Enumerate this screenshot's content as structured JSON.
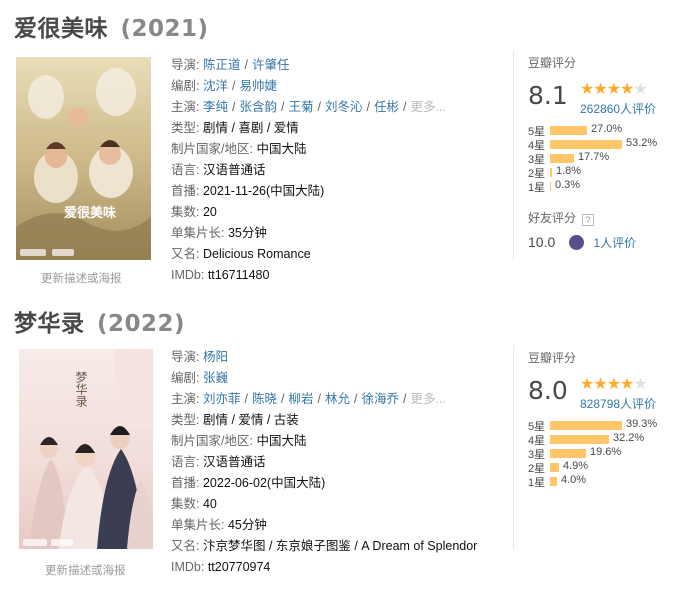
{
  "entries": [
    {
      "title": "爱很美味",
      "year": "(2021)",
      "update_link": "更新描述或海报",
      "poster": {
        "overlay_title": "爱很美味"
      },
      "info": {
        "director_label": "导演:",
        "directors": [
          "陈正道",
          "许肇任"
        ],
        "writer_label": "编剧:",
        "writers": [
          "沈洋",
          "易帅婕"
        ],
        "cast_label": "主演:",
        "cast": [
          "李纯",
          "张含韵",
          "王菊",
          "刘冬沁",
          "任彬"
        ],
        "cast_more": "更多...",
        "genre_label": "类型:",
        "genres": "剧情 / 喜剧 / 爱情",
        "region_label": "制片国家/地区:",
        "region": "中国大陆",
        "language_label": "语言:",
        "language": "汉语普通话",
        "premiere_label": "首播:",
        "premiere": "2021-11-26(中国大陆)",
        "episodes_label": "集数:",
        "episodes": "20",
        "runtime_label": "单集片长:",
        "runtime": "35分钟",
        "aka_label": "又名:",
        "aka": "Delicious Romance",
        "imdb_label": "IMDb:",
        "imdb": "tt16711480"
      },
      "rating": {
        "label": "豆瓣评分",
        "score": "8.1",
        "stars": 4,
        "count": "262860人评价",
        "breakdown": [
          {
            "label": "5星",
            "pct": "27.0%",
            "value": 27.0
          },
          {
            "label": "4星",
            "pct": "53.2%",
            "value": 53.2
          },
          {
            "label": "3星",
            "pct": "17.7%",
            "value": 17.7
          },
          {
            "label": "2星",
            "pct": "1.8%",
            "value": 1.8
          },
          {
            "label": "1星",
            "pct": "0.3%",
            "value": 0.3
          }
        ],
        "friend_label": "好友评分",
        "friend_help": "?",
        "friend_score": "10.0",
        "friend_count": "1人评价"
      }
    },
    {
      "title": "梦华录",
      "year": "(2022)",
      "update_link": "更新描述或海报",
      "poster": {
        "overlay_title": "梦华录"
      },
      "info": {
        "director_label": "导演:",
        "directors": [
          "杨阳"
        ],
        "writer_label": "编剧:",
        "writers": [
          "张巍"
        ],
        "cast_label": "主演:",
        "cast": [
          "刘亦菲",
          "陈晓",
          "柳岩",
          "林允",
          "徐海乔"
        ],
        "cast_more": "更多...",
        "genre_label": "类型:",
        "genres": "剧情 / 爱情 / 古装",
        "region_label": "制片国家/地区:",
        "region": "中国大陆",
        "language_label": "语言:",
        "language": "汉语普通话",
        "premiere_label": "首播:",
        "premiere": "2022-06-02(中国大陆)",
        "episodes_label": "集数:",
        "episodes": "40",
        "runtime_label": "单集片长:",
        "runtime": "45分钟",
        "aka_label": "又名:",
        "aka": "汴京梦华图 / 东京娘子图鉴 / A Dream of Splendor",
        "imdb_label": "IMDb:",
        "imdb": "tt20770974"
      },
      "rating": {
        "label": "豆瓣评分",
        "score": "8.0",
        "stars": 4,
        "count": "828798人评价",
        "breakdown": [
          {
            "label": "5星",
            "pct": "39.3%",
            "value": 39.3
          },
          {
            "label": "4星",
            "pct": "32.2%",
            "value": 32.2
          },
          {
            "label": "3星",
            "pct": "19.6%",
            "value": 19.6
          },
          {
            "label": "2星",
            "pct": "4.9%",
            "value": 4.9
          },
          {
            "label": "1星",
            "pct": "4.0%",
            "value": 4.0
          }
        ]
      }
    }
  ],
  "colors": {
    "link": "#3377aa",
    "star": "#ffac2d",
    "bar": "#ffc76a",
    "title": "#494949"
  }
}
